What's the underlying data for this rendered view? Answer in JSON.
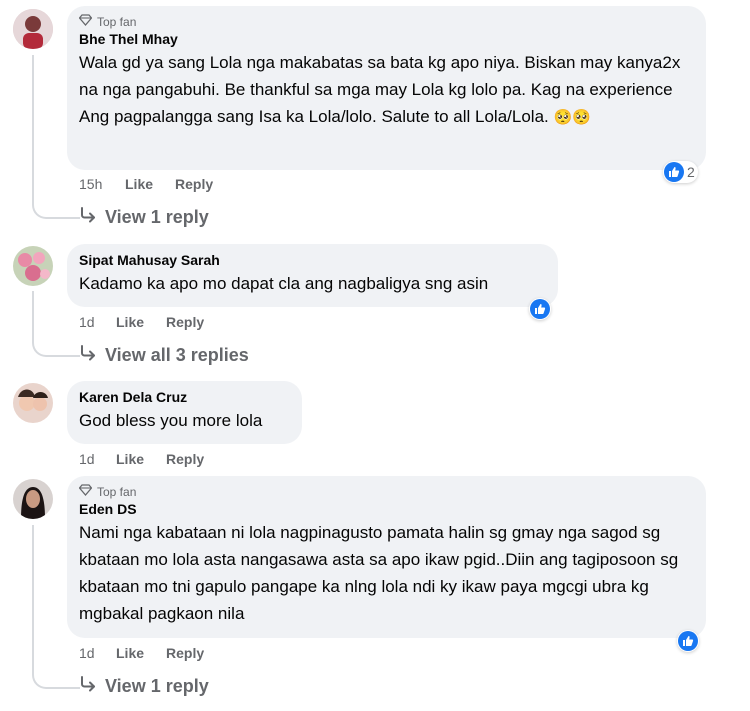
{
  "comments": [
    {
      "top_fan": "Top fan",
      "name": "Bhe Thel Mhay",
      "text": "Wala gd ya sang Lola nga makabatas sa bata kg apo niya. Biskan may kanya2x na nga pangabuhi. Be thankful sa mga may Lola kg lolo pa. Kag na experience Ang pagpalangga sang Isa ka Lola/lolo. Salute to all Lola/Lola.",
      "emoji": "🥺🥺",
      "time": "15h",
      "like": "Like",
      "reply": "Reply",
      "reaction_count": "2",
      "view_replies": "View 1 reply"
    },
    {
      "name": "Sipat Mahusay Sarah",
      "text": "Kadamo ka apo mo dapat cla ang nagbaligya sng asin",
      "time": "1d",
      "like": "Like",
      "reply": "Reply",
      "view_replies": "View all 3 replies"
    },
    {
      "name": "Karen Dela Cruz",
      "text": "God bless you more lola",
      "time": "1d",
      "like": "Like",
      "reply": "Reply"
    },
    {
      "top_fan": "Top fan",
      "name": "Eden DS",
      "text": "Nami nga kabataan ni lola nagpinagusto pamata halin sg gmay nga sagod sg kbataan mo lola asta nangasawa asta sa apo ikaw pgid..Diin ang tagiposoon sg kbataan mo tni gapulo pangape ka nlng lola ndi ky ikaw paya mgcgi ubra kg mgbakal pagkaon nila",
      "time": "1d",
      "like": "Like",
      "reply": "Reply",
      "view_replies": "View 1 reply"
    }
  ],
  "colors": {
    "bubble": "#f0f2f5",
    "muted": "#65676b",
    "like_blue": "#1877f2"
  }
}
